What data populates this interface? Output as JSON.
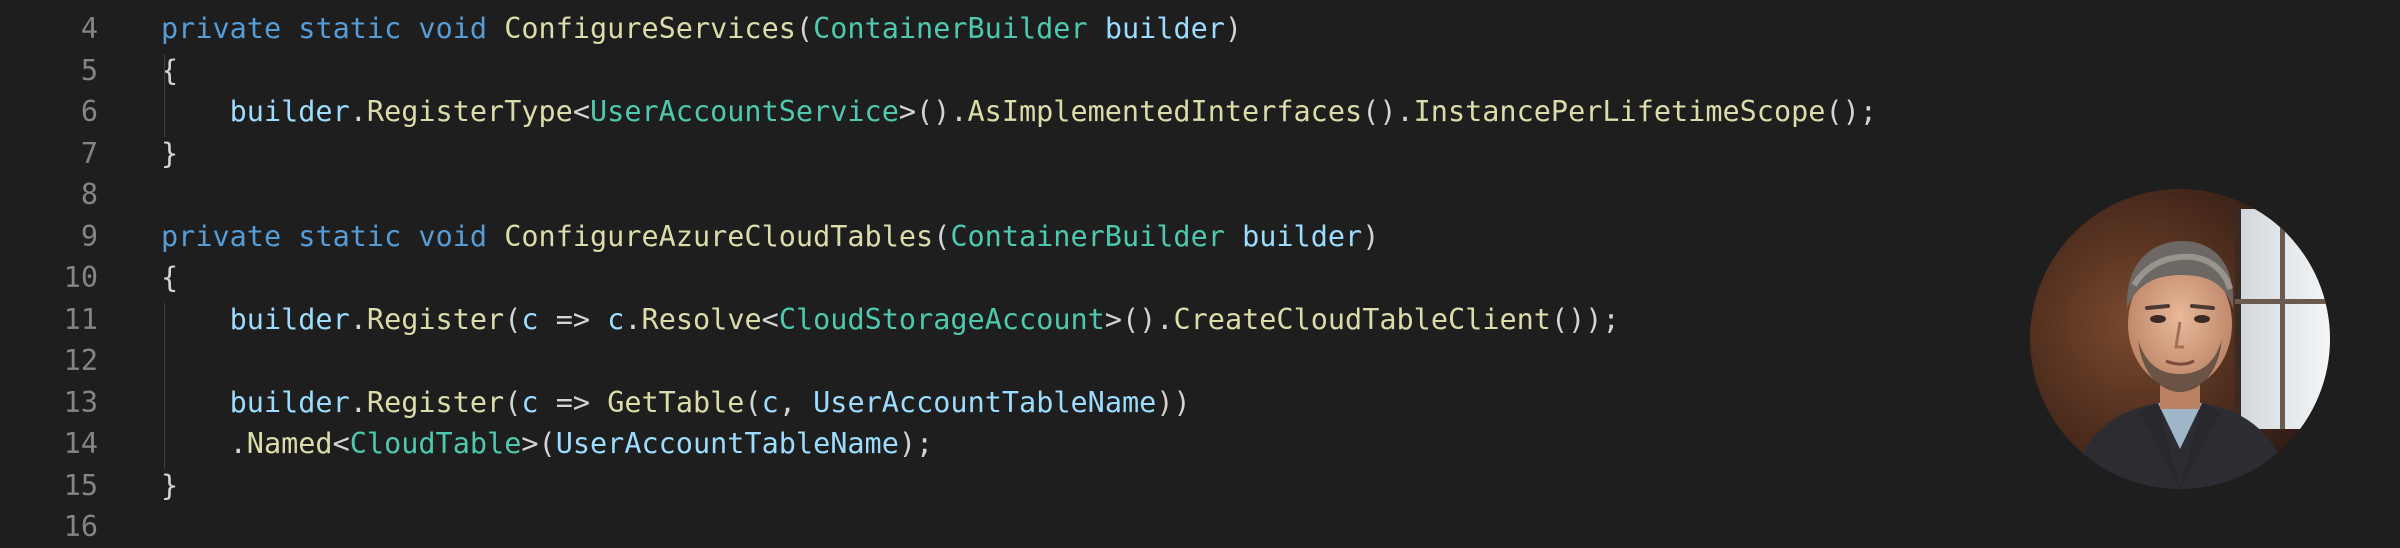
{
  "colors": {
    "background": "#1e1e1e",
    "line_number": "#858585",
    "keyword": "#569cd6",
    "function": "#dcdcaa",
    "type": "#4ec9b0",
    "variable": "#9cdcfe",
    "punctuation": "#d4d4d4"
  },
  "avatar": {
    "icon": "person-photo-icon"
  },
  "editor": {
    "lines": [
      {
        "number": "4",
        "tokens": [
          {
            "t": "private",
            "k": "kw"
          },
          {
            "t": " ",
            "k": "punct"
          },
          {
            "t": "static",
            "k": "kw"
          },
          {
            "t": " ",
            "k": "punct"
          },
          {
            "t": "void",
            "k": "kw"
          },
          {
            "t": " ",
            "k": "punct"
          },
          {
            "t": "ConfigureServices",
            "k": "fn"
          },
          {
            "t": "(",
            "k": "punct"
          },
          {
            "t": "ContainerBuilder",
            "k": "type"
          },
          {
            "t": " ",
            "k": "punct"
          },
          {
            "t": "builder",
            "k": "var"
          },
          {
            "t": ")",
            "k": "punct"
          }
        ]
      },
      {
        "number": "5",
        "tokens": [
          {
            "t": "{",
            "k": "punct"
          }
        ]
      },
      {
        "number": "6",
        "tokens": [
          {
            "t": "    ",
            "k": "punct"
          },
          {
            "t": "builder",
            "k": "var"
          },
          {
            "t": ".",
            "k": "punct"
          },
          {
            "t": "RegisterType",
            "k": "fn"
          },
          {
            "t": "<",
            "k": "punct"
          },
          {
            "t": "UserAccountService",
            "k": "type"
          },
          {
            "t": ">().",
            "k": "punct"
          },
          {
            "t": "AsImplementedInterfaces",
            "k": "fn"
          },
          {
            "t": "().",
            "k": "punct"
          },
          {
            "t": "InstancePerLifetimeScope",
            "k": "fn"
          },
          {
            "t": "();",
            "k": "punct"
          }
        ]
      },
      {
        "number": "7",
        "tokens": [
          {
            "t": "}",
            "k": "punct"
          }
        ]
      },
      {
        "number": "8",
        "tokens": []
      },
      {
        "number": "9",
        "tokens": [
          {
            "t": "private",
            "k": "kw"
          },
          {
            "t": " ",
            "k": "punct"
          },
          {
            "t": "static",
            "k": "kw"
          },
          {
            "t": " ",
            "k": "punct"
          },
          {
            "t": "void",
            "k": "kw"
          },
          {
            "t": " ",
            "k": "punct"
          },
          {
            "t": "ConfigureAzureCloudTables",
            "k": "fn"
          },
          {
            "t": "(",
            "k": "punct"
          },
          {
            "t": "ContainerBuilder",
            "k": "type"
          },
          {
            "t": " ",
            "k": "punct"
          },
          {
            "t": "builder",
            "k": "var"
          },
          {
            "t": ")",
            "k": "punct"
          }
        ]
      },
      {
        "number": "10",
        "tokens": [
          {
            "t": "{",
            "k": "punct"
          }
        ]
      },
      {
        "number": "11",
        "tokens": [
          {
            "t": "    ",
            "k": "punct"
          },
          {
            "t": "builder",
            "k": "var"
          },
          {
            "t": ".",
            "k": "punct"
          },
          {
            "t": "Register",
            "k": "fn"
          },
          {
            "t": "(",
            "k": "punct"
          },
          {
            "t": "c",
            "k": "var"
          },
          {
            "t": " => ",
            "k": "punct"
          },
          {
            "t": "c",
            "k": "var"
          },
          {
            "t": ".",
            "k": "punct"
          },
          {
            "t": "Resolve",
            "k": "fn"
          },
          {
            "t": "<",
            "k": "punct"
          },
          {
            "t": "CloudStorageAccount",
            "k": "type"
          },
          {
            "t": ">().",
            "k": "punct"
          },
          {
            "t": "CreateCloudTableClient",
            "k": "fn"
          },
          {
            "t": "());",
            "k": "punct"
          }
        ]
      },
      {
        "number": "12",
        "tokens": []
      },
      {
        "number": "13",
        "tokens": [
          {
            "t": "    ",
            "k": "punct"
          },
          {
            "t": "builder",
            "k": "var"
          },
          {
            "t": ".",
            "k": "punct"
          },
          {
            "t": "Register",
            "k": "fn"
          },
          {
            "t": "(",
            "k": "punct"
          },
          {
            "t": "c",
            "k": "var"
          },
          {
            "t": " => ",
            "k": "punct"
          },
          {
            "t": "GetTable",
            "k": "fn"
          },
          {
            "t": "(",
            "k": "punct"
          },
          {
            "t": "c",
            "k": "var"
          },
          {
            "t": ", ",
            "k": "punct"
          },
          {
            "t": "UserAccountTableName",
            "k": "var"
          },
          {
            "t": "))",
            "k": "punct"
          }
        ]
      },
      {
        "number": "14",
        "tokens": [
          {
            "t": "    .",
            "k": "punct"
          },
          {
            "t": "Named",
            "k": "fn"
          },
          {
            "t": "<",
            "k": "punct"
          },
          {
            "t": "CloudTable",
            "k": "type"
          },
          {
            "t": ">(",
            "k": "punct"
          },
          {
            "t": "UserAccountTableName",
            "k": "var"
          },
          {
            "t": ");",
            "k": "punct"
          }
        ]
      },
      {
        "number": "15",
        "tokens": [
          {
            "t": "}",
            "k": "punct"
          }
        ]
      },
      {
        "number": "16",
        "tokens": []
      }
    ]
  }
}
